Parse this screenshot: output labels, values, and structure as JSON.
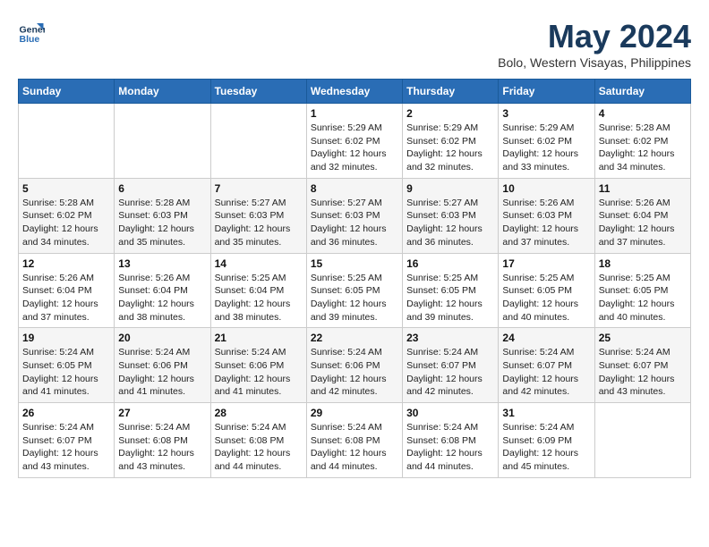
{
  "logo": {
    "line1": "General",
    "line2": "Blue"
  },
  "title": "May 2024",
  "location": "Bolo, Western Visayas, Philippines",
  "weekdays": [
    "Sunday",
    "Monday",
    "Tuesday",
    "Wednesday",
    "Thursday",
    "Friday",
    "Saturday"
  ],
  "weeks": [
    [
      {
        "day": "",
        "info": ""
      },
      {
        "day": "",
        "info": ""
      },
      {
        "day": "",
        "info": ""
      },
      {
        "day": "1",
        "info": "Sunrise: 5:29 AM\nSunset: 6:02 PM\nDaylight: 12 hours\nand 32 minutes."
      },
      {
        "day": "2",
        "info": "Sunrise: 5:29 AM\nSunset: 6:02 PM\nDaylight: 12 hours\nand 32 minutes."
      },
      {
        "day": "3",
        "info": "Sunrise: 5:29 AM\nSunset: 6:02 PM\nDaylight: 12 hours\nand 33 minutes."
      },
      {
        "day": "4",
        "info": "Sunrise: 5:28 AM\nSunset: 6:02 PM\nDaylight: 12 hours\nand 34 minutes."
      }
    ],
    [
      {
        "day": "5",
        "info": "Sunrise: 5:28 AM\nSunset: 6:02 PM\nDaylight: 12 hours\nand 34 minutes."
      },
      {
        "day": "6",
        "info": "Sunrise: 5:28 AM\nSunset: 6:03 PM\nDaylight: 12 hours\nand 35 minutes."
      },
      {
        "day": "7",
        "info": "Sunrise: 5:27 AM\nSunset: 6:03 PM\nDaylight: 12 hours\nand 35 minutes."
      },
      {
        "day": "8",
        "info": "Sunrise: 5:27 AM\nSunset: 6:03 PM\nDaylight: 12 hours\nand 36 minutes."
      },
      {
        "day": "9",
        "info": "Sunrise: 5:27 AM\nSunset: 6:03 PM\nDaylight: 12 hours\nand 36 minutes."
      },
      {
        "day": "10",
        "info": "Sunrise: 5:26 AM\nSunset: 6:03 PM\nDaylight: 12 hours\nand 37 minutes."
      },
      {
        "day": "11",
        "info": "Sunrise: 5:26 AM\nSunset: 6:04 PM\nDaylight: 12 hours\nand 37 minutes."
      }
    ],
    [
      {
        "day": "12",
        "info": "Sunrise: 5:26 AM\nSunset: 6:04 PM\nDaylight: 12 hours\nand 37 minutes."
      },
      {
        "day": "13",
        "info": "Sunrise: 5:26 AM\nSunset: 6:04 PM\nDaylight: 12 hours\nand 38 minutes."
      },
      {
        "day": "14",
        "info": "Sunrise: 5:25 AM\nSunset: 6:04 PM\nDaylight: 12 hours\nand 38 minutes."
      },
      {
        "day": "15",
        "info": "Sunrise: 5:25 AM\nSunset: 6:05 PM\nDaylight: 12 hours\nand 39 minutes."
      },
      {
        "day": "16",
        "info": "Sunrise: 5:25 AM\nSunset: 6:05 PM\nDaylight: 12 hours\nand 39 minutes."
      },
      {
        "day": "17",
        "info": "Sunrise: 5:25 AM\nSunset: 6:05 PM\nDaylight: 12 hours\nand 40 minutes."
      },
      {
        "day": "18",
        "info": "Sunrise: 5:25 AM\nSunset: 6:05 PM\nDaylight: 12 hours\nand 40 minutes."
      }
    ],
    [
      {
        "day": "19",
        "info": "Sunrise: 5:24 AM\nSunset: 6:05 PM\nDaylight: 12 hours\nand 41 minutes."
      },
      {
        "day": "20",
        "info": "Sunrise: 5:24 AM\nSunset: 6:06 PM\nDaylight: 12 hours\nand 41 minutes."
      },
      {
        "day": "21",
        "info": "Sunrise: 5:24 AM\nSunset: 6:06 PM\nDaylight: 12 hours\nand 41 minutes."
      },
      {
        "day": "22",
        "info": "Sunrise: 5:24 AM\nSunset: 6:06 PM\nDaylight: 12 hours\nand 42 minutes."
      },
      {
        "day": "23",
        "info": "Sunrise: 5:24 AM\nSunset: 6:07 PM\nDaylight: 12 hours\nand 42 minutes."
      },
      {
        "day": "24",
        "info": "Sunrise: 5:24 AM\nSunset: 6:07 PM\nDaylight: 12 hours\nand 42 minutes."
      },
      {
        "day": "25",
        "info": "Sunrise: 5:24 AM\nSunset: 6:07 PM\nDaylight: 12 hours\nand 43 minutes."
      }
    ],
    [
      {
        "day": "26",
        "info": "Sunrise: 5:24 AM\nSunset: 6:07 PM\nDaylight: 12 hours\nand 43 minutes."
      },
      {
        "day": "27",
        "info": "Sunrise: 5:24 AM\nSunset: 6:08 PM\nDaylight: 12 hours\nand 43 minutes."
      },
      {
        "day": "28",
        "info": "Sunrise: 5:24 AM\nSunset: 6:08 PM\nDaylight: 12 hours\nand 44 minutes."
      },
      {
        "day": "29",
        "info": "Sunrise: 5:24 AM\nSunset: 6:08 PM\nDaylight: 12 hours\nand 44 minutes."
      },
      {
        "day": "30",
        "info": "Sunrise: 5:24 AM\nSunset: 6:08 PM\nDaylight: 12 hours\nand 44 minutes."
      },
      {
        "day": "31",
        "info": "Sunrise: 5:24 AM\nSunset: 6:09 PM\nDaylight: 12 hours\nand 45 minutes."
      },
      {
        "day": "",
        "info": ""
      }
    ]
  ]
}
